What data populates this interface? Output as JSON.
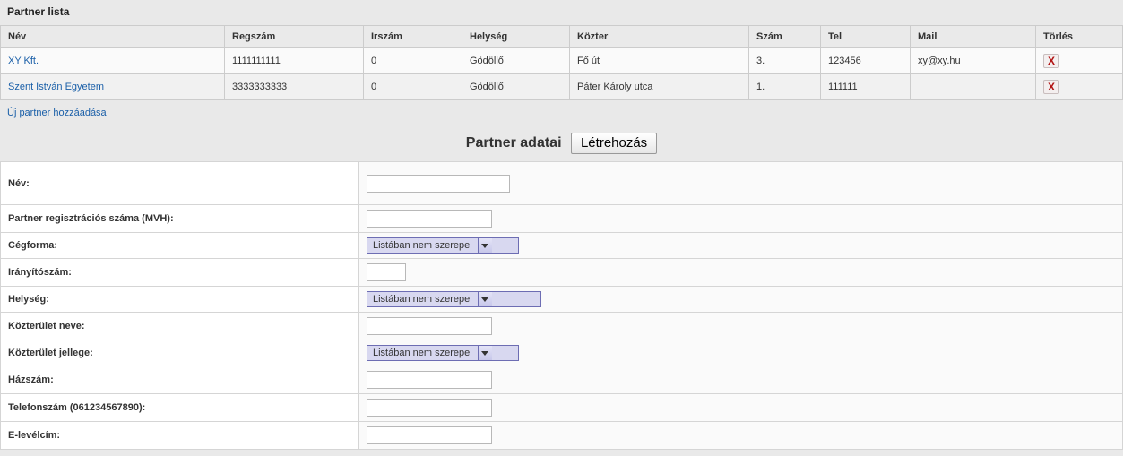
{
  "page_title": "Partner lista",
  "table": {
    "headers": [
      "Név",
      "Regszám",
      "Irszám",
      "Helység",
      "Közter",
      "Szám",
      "Tel",
      "Mail",
      "Törlés"
    ],
    "rows": [
      {
        "nev": "XY Kft.",
        "regszam": "1111111111",
        "irszam": "0",
        "helyseg": "Gödöllő",
        "kozter": "Fő út",
        "szam": "3.",
        "tel": "123456",
        "mail": "xy@xy.hu"
      },
      {
        "nev": "Szent István Egyetem",
        "regszam": "3333333333",
        "irszam": "0",
        "helyseg": "Gödöllő",
        "kozter": "Páter Károly utca",
        "szam": "1.",
        "tel": "111111",
        "mail": ""
      }
    ]
  },
  "add_link": "Új partner hozzáadása",
  "section": {
    "title": "Partner adatai",
    "create_btn": "Létrehozás"
  },
  "form": {
    "nev_label": "Név:",
    "reg_label": "Partner regisztrációs száma (MVH):",
    "ceg_label": "Cégforma:",
    "ir_label": "Irányítószám:",
    "hely_label": "Helység:",
    "kozt_label": "Közterület neve:",
    "koztj_label": "Közterület jellege:",
    "haz_label": "Házszám:",
    "tel_label": "Telefonszám (061234567890):",
    "email_label": "E-levélcím:",
    "combo_placeholder": "Listában nem szerepel",
    "nev_value": "",
    "reg_value": "",
    "ir_value": "",
    "kozt_value": "",
    "haz_value": "",
    "tel_value": "",
    "email_value": ""
  },
  "icons": {
    "delete": "X"
  }
}
